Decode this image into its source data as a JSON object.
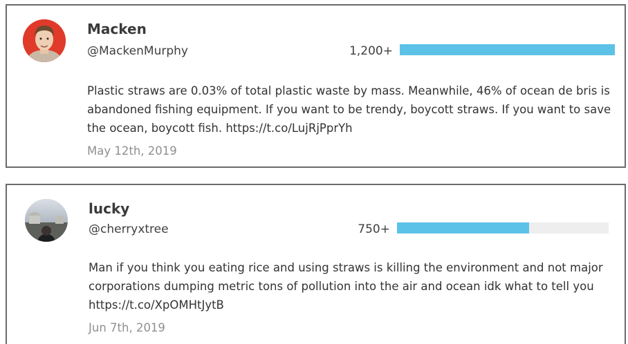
{
  "tweets": [
    {
      "display_name": "Macken",
      "handle": "@MackenMurphy",
      "count_label": "1,200+",
      "count_fraction": 1.0,
      "text": "Plastic straws are 0.03% of total plastic waste by mass. Meanwhile, 46% of ocean de bris is abandoned fishing equipment. If you want to be trendy, boycott straws. If you want to save the ocean, boycott fish. https://t.co/LujRjPprYh",
      "date": "May 12th, 2019"
    },
    {
      "display_name": "lucky",
      "handle": "@cherryxtree",
      "count_label": "750+",
      "count_fraction": 0.625,
      "text": "Man if you think you eating rice and using straws is killing the environment and not major corporations dumping metric tons of pollution into the air and ocean idk what to tell you https://t.co/XpOMHtJytB",
      "date": "Jun 7th, 2019"
    }
  ],
  "colors": {
    "meter_fill": "#5dc2e8",
    "meter_track": "#eeeeee",
    "card_border": "#6a6a6a"
  }
}
